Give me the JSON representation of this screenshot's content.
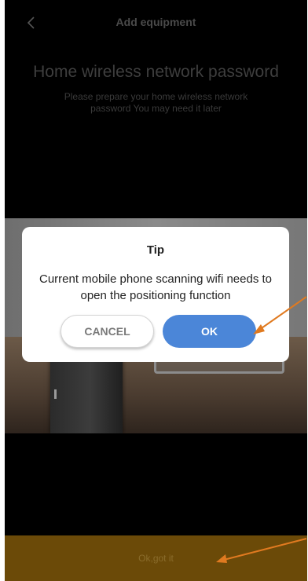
{
  "header": {
    "title": "Add equipment",
    "back_icon": "chevron-left-icon"
  },
  "main": {
    "heading": "Home wireless network password",
    "subtext": "Please prepare your home wireless network password You may need it later"
  },
  "dialog": {
    "title": "Tip",
    "message": "Current mobile phone scanning wifi needs to open the positioning function",
    "cancel_label": "CANCEL",
    "ok_label": "OK"
  },
  "bottom_bar": {
    "label": "Ok,got it"
  },
  "colors": {
    "ok_button": "#4b86d8",
    "bottom_bar": "#6b4a08",
    "annotation_arrow": "#e07a20"
  }
}
